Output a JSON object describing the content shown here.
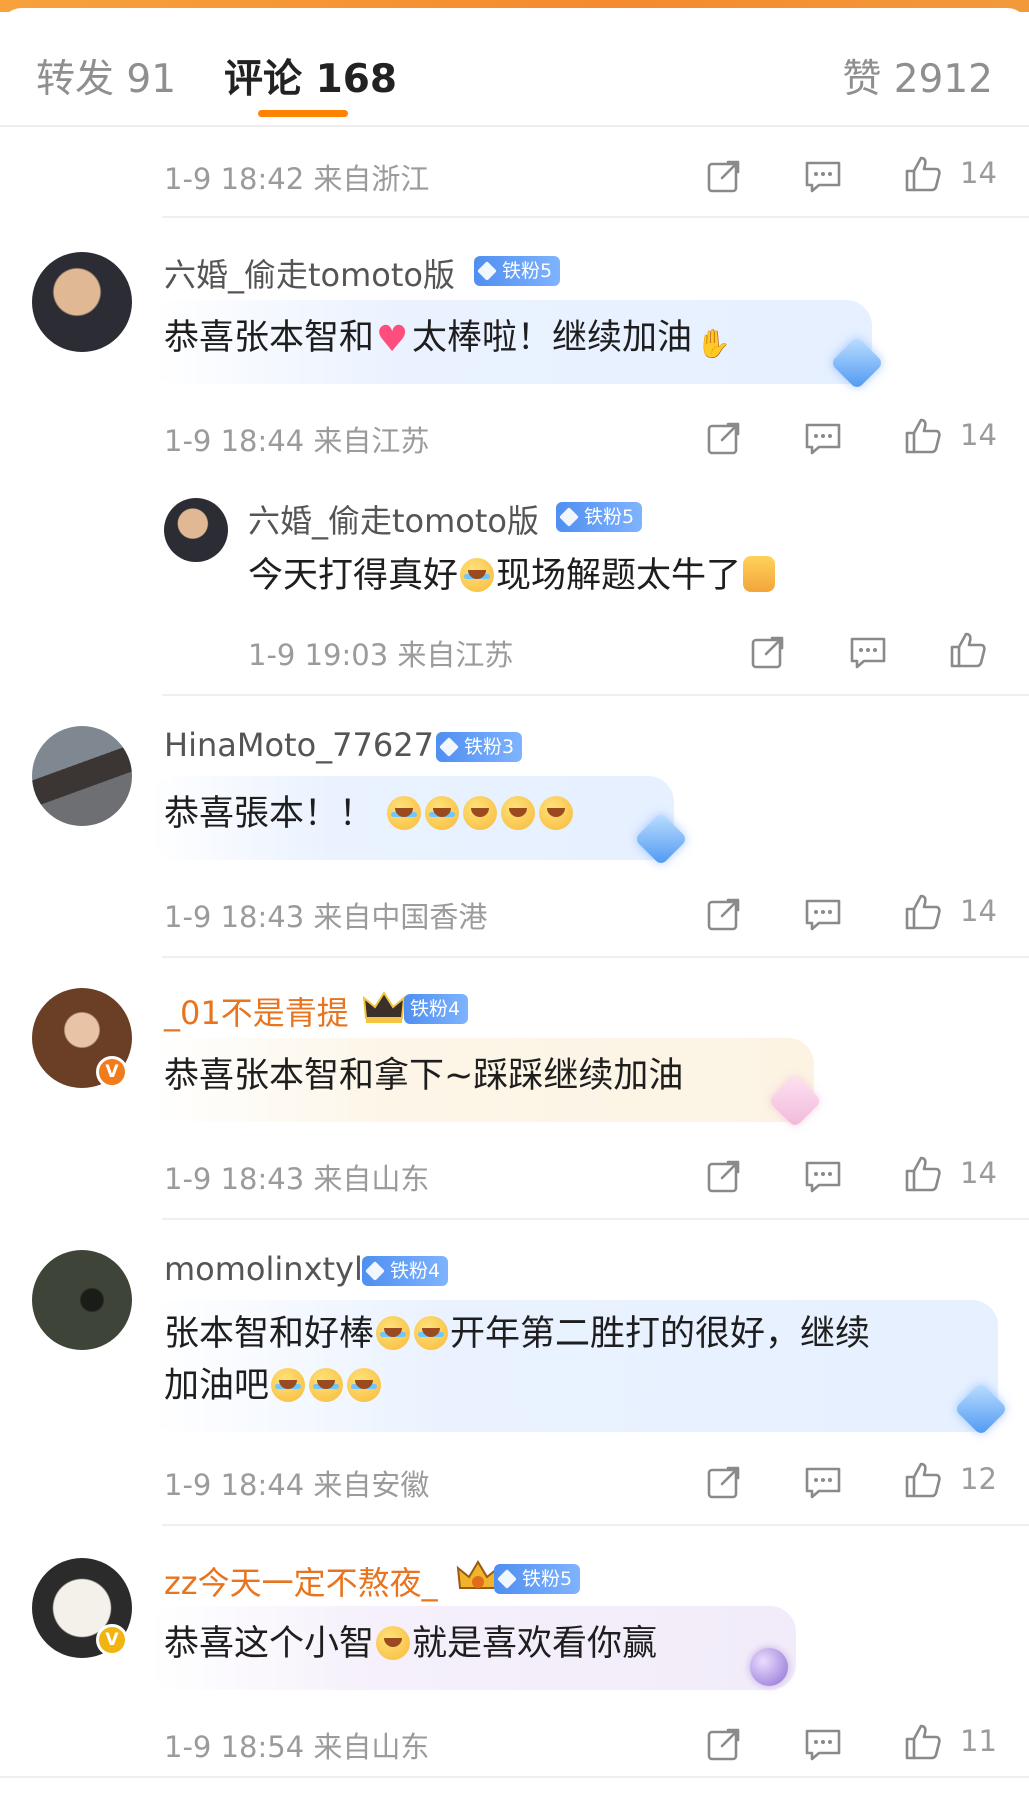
{
  "tabs": {
    "repost": "转发 91",
    "comments": "评论 168",
    "likes": "赞 2912"
  },
  "colors": {
    "accent": "#ff8200",
    "fan_badge": "#4f8ff0",
    "orange_name": "#e8741f"
  },
  "top_row": {
    "meta": "1-9 18:42  来自浙江",
    "likes": "14"
  },
  "comments": [
    {
      "user": "六婚_偷走tomoto版",
      "fan_badge": "铁粉5",
      "text_a": "恭喜张本智和",
      "text_b": "太棒啦！继续加油",
      "meta": "1-9 18:44  来自江苏",
      "likes": "14",
      "reply": {
        "user": "六婚_偷走tomoto版",
        "fan_badge": "铁粉5",
        "text_a": "今天打得真好",
        "text_b": "现场解题太牛了",
        "meta": "1-9 19:03  来自江苏"
      }
    },
    {
      "user": "HinaMoto_77627",
      "fan_badge": "铁粉3",
      "text_a": "恭喜張本！！",
      "meta": "1-9 18:43  来自中国香港",
      "likes": "14"
    },
    {
      "user": "_01不是青提",
      "fan_badge": "铁粉4",
      "text_a": "恭喜张本智和拿下~踩踩继续加油",
      "meta": "1-9 18:43  来自山东",
      "likes": "14"
    },
    {
      "user": "momolinxtyl",
      "fan_badge": "铁粉4",
      "text_a": "张本智和好棒",
      "text_b": "开年第二胜打的很好，继续",
      "text_c": "加油吧",
      "meta": "1-9 18:44  来自安徽",
      "likes": "12"
    },
    {
      "user": "zz今天一定不熬夜_",
      "fan_badge": "铁粉5",
      "text_a": "恭喜这个小智",
      "text_b": "就是喜欢看你赢",
      "meta": "1-9 18:54  来自山东",
      "likes": "11"
    }
  ]
}
